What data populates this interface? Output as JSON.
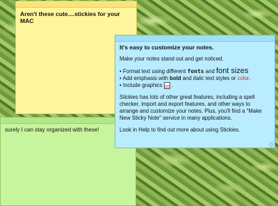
{
  "notes": {
    "yellow": {
      "text": "Aren't these cute....stickies for your MAC",
      "color": "#fef59c"
    },
    "green": {
      "text": "surely I can stay organized with these!",
      "color": "#c7f59e"
    },
    "blue": {
      "color": "#b9ecff",
      "heading": "It's easy to customize your notes.",
      "intro": "Make your notes stand out and get noticed.",
      "bullets": {
        "b1_pre": "Format text using different ",
        "b1_fonts": "fonts",
        "b1_and": " and ",
        "b1_sizes": "font sizes",
        "b2_pre": "Add emphasis with ",
        "b2_bold": "bold",
        "b2_and": " and ",
        "b2_italic": "italic",
        "b2_mid": " text styles or ",
        "b2_color": "color",
        "b2_end": ".",
        "b3_pre": "Include graphics ",
        "b3_end": " ."
      },
      "body": "Stickies has lots of other great features, including a spell checker, import and export features, and other ways to arrange and customize your notes. Plus, you'll find a \"Make New Sticky Note\" service in many applications.",
      "footer": "Look in Help to find out more about using Stickies."
    }
  }
}
